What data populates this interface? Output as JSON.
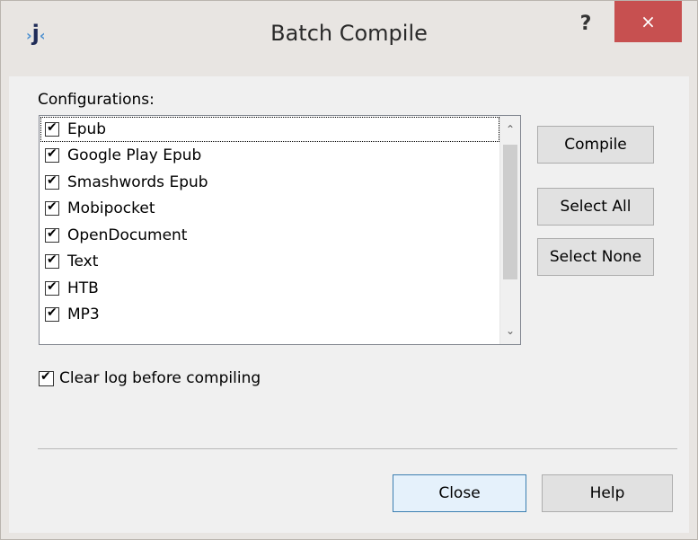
{
  "window": {
    "title": "Batch Compile",
    "help_glyph": "?",
    "close_glyph": "×"
  },
  "configurations": {
    "label": "Configurations:",
    "items": [
      {
        "label": "Epub",
        "checked": true
      },
      {
        "label": "Google Play Epub",
        "checked": true
      },
      {
        "label": "Smashwords Epub",
        "checked": true
      },
      {
        "label": "Mobipocket",
        "checked": true
      },
      {
        "label": "OpenDocument",
        "checked": true
      },
      {
        "label": "Text",
        "checked": true
      },
      {
        "label": "HTB",
        "checked": true
      },
      {
        "label": "MP3",
        "checked": true
      }
    ]
  },
  "buttons": {
    "compile": "Compile",
    "select_all": "Select All",
    "select_none": "Select None",
    "close": "Close",
    "help": "Help"
  },
  "options": {
    "clear_log_label": "Clear log before compiling",
    "clear_log_checked": true
  },
  "icons": {
    "app": "app-logo-icon",
    "scroll_up": "chevron-up-icon",
    "scroll_down": "chevron-down-icon",
    "check": "check-icon"
  },
  "colors": {
    "close_button": "#c75050",
    "dialog_bg": "#f0f0f0",
    "title_bg": "#e8e5e2"
  }
}
